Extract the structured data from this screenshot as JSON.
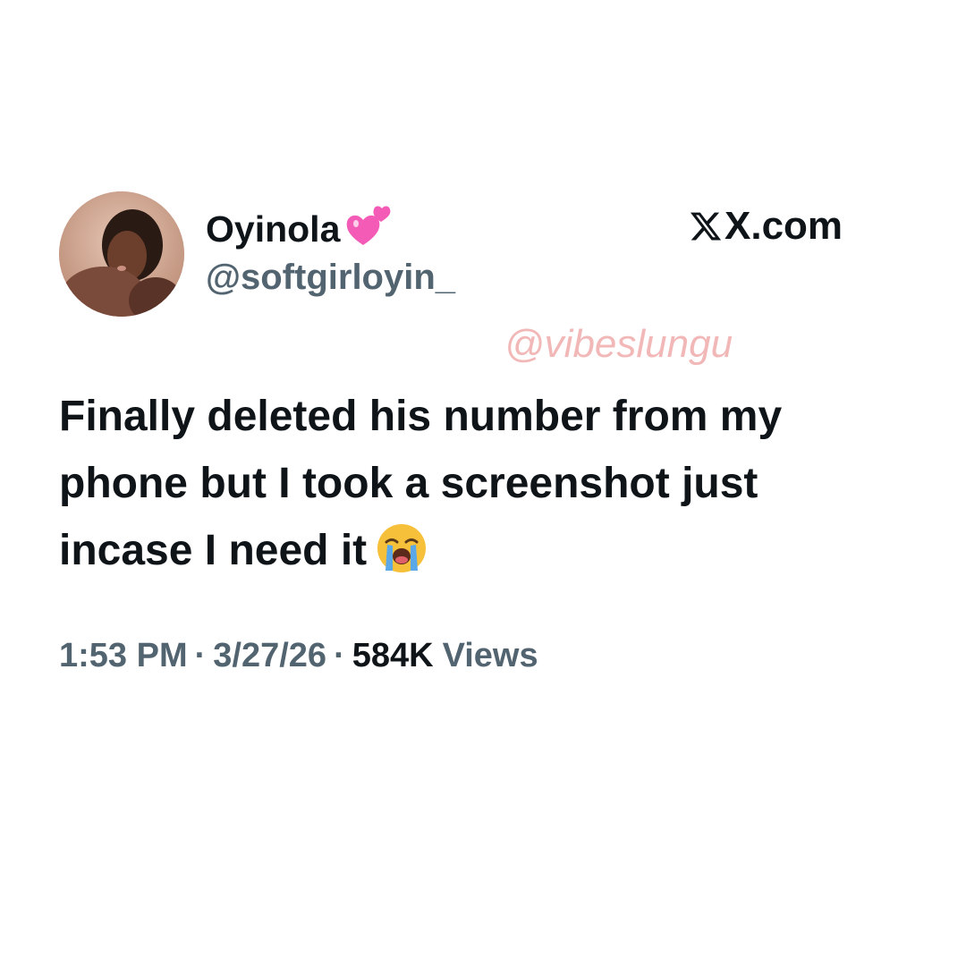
{
  "tweet": {
    "author": {
      "display_name": "Oyinola",
      "name_emoji": "two-hearts-emoji",
      "handle": "@softgirloyin_",
      "avatar": "profile-photo"
    },
    "site_label": "X.com",
    "site_icon": "x-logo-icon",
    "watermark": "@vibeslungu",
    "text_lines": [
      "Finally deleted his number from my",
      "phone but I took a screenshot just",
      "incase I need it"
    ],
    "text_emoji": "loudly-crying-face-emoji",
    "meta": {
      "time": "1:53 PM",
      "separator": "·",
      "date": "3/27/26",
      "views_count": "584K",
      "views_label": "Views"
    }
  },
  "colors": {
    "text_primary": "#0f1419",
    "text_secondary": "#536471",
    "watermark": "#f2b8b8",
    "heart": "#f45bb7"
  }
}
